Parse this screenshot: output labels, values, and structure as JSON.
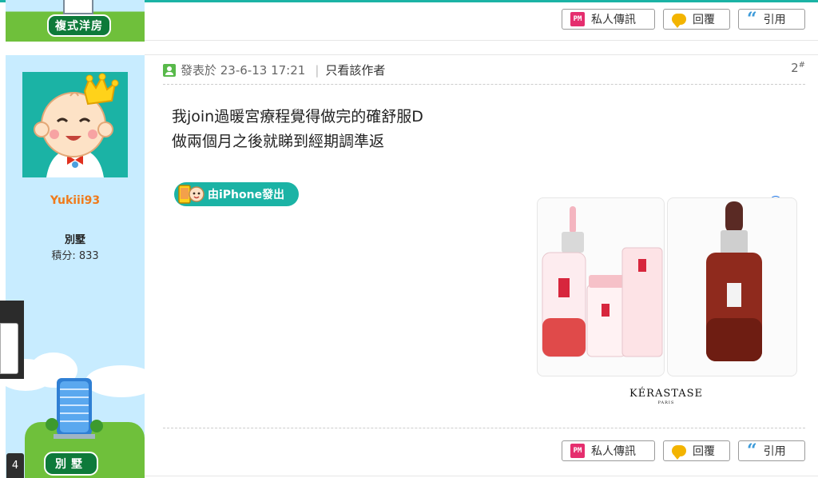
{
  "prev_post": {
    "rank_badge": "複式洋房"
  },
  "actions": {
    "pm": "私人傳訊",
    "reply": "回覆",
    "quote": "引用",
    "pm_icon_text": "PM"
  },
  "post": {
    "author": "Yukiii93",
    "rank": "別墅",
    "score": "積分: 833",
    "rank_plate": "別墅",
    "posted_at": "發表於 23-6-13 17:21",
    "only_author": "只看該作者",
    "floor": "2",
    "floor_mark": "#",
    "message_lines": [
      "我join過暖宮療程覺得做完的確舒服D",
      "做兩個月之後就睇到經期調準返"
    ],
    "device_badge": "由iPhone發出"
  },
  "ad": {
    "brand": "KÉRASTASE",
    "brand_sub": "PARIS",
    "info_icon": "i",
    "close_icon": "✕"
  },
  "page_tag": "4",
  "colors": {
    "accent": "#1bb3a5",
    "sidebar": "#c8ecff",
    "username": "#f07a1b"
  }
}
